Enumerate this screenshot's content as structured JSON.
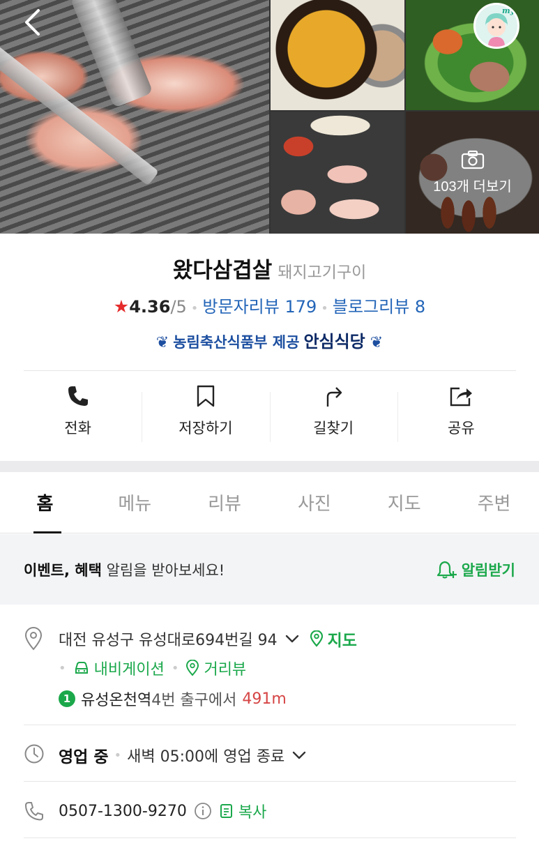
{
  "photos": {
    "more_label": "103개 더보기"
  },
  "header": {
    "back_icon": "chevron-left-icon",
    "avatar_label": "my"
  },
  "place": {
    "name": "왔다삼겹살",
    "category": "돼지고기구이",
    "rating": "4.36",
    "rating_max": "/5",
    "visitor_reviews": "방문자리뷰 179",
    "blog_reviews": "블로그리뷰 8",
    "certification_text": "농림축산식품부 제공",
    "certification_badge": "안심식당"
  },
  "actions": [
    {
      "label": "전화",
      "icon": "phone-icon"
    },
    {
      "label": "저장하기",
      "icon": "bookmark-icon"
    },
    {
      "label": "길찾기",
      "icon": "directions-icon"
    },
    {
      "label": "공유",
      "icon": "share-icon"
    }
  ],
  "tabs": [
    "홈",
    "메뉴",
    "리뷰",
    "사진",
    "지도",
    "주변"
  ],
  "active_tab": "홈",
  "notice": {
    "bold_text": "이벤트, 혜택",
    "text": " 알림을 받아보세요!",
    "action_label": "알림받기"
  },
  "address": {
    "text": "대전 유성구 유성대로694번길 94",
    "map_label": "지도",
    "navigation_label": "내비게이션",
    "streetview_label": "거리뷰"
  },
  "subway": {
    "line": "1",
    "station": "유성온천역",
    "exit_text": " 4번 출구에서",
    "distance": "491m"
  },
  "hours": {
    "status": "영업 중",
    "closing": "새벽 05:00에 영업 종료"
  },
  "phone": {
    "number": "0507-1300-9270",
    "copy_label": "복사"
  },
  "colors": {
    "green": "#1ba84b",
    "blue_link": "#2365b8",
    "star_red": "#e52b2b",
    "distance_red": "#d64545"
  }
}
